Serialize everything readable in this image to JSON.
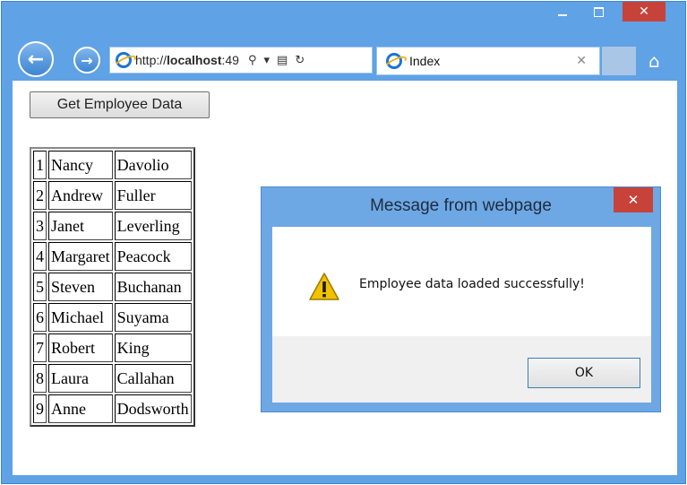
{
  "browser": {
    "url_prefix": "http://",
    "url_host": "localhost",
    "url_rest": ":49",
    "tab_title": "Index",
    "window_controls": {
      "minimize_icon": "minimize-icon",
      "maximize_icon": "maximize-icon",
      "close_glyph": "✕"
    },
    "icons": {
      "back": "←",
      "forward": "→",
      "search": "⚲",
      "dropdown": "▾",
      "compat": "▤",
      "refresh": "↻",
      "tab_close": "✕",
      "home": "⌂"
    }
  },
  "page": {
    "button_label": "Get Employee Data",
    "employees": [
      {
        "id": "1",
        "first": "Nancy",
        "last": "Davolio"
      },
      {
        "id": "2",
        "first": "Andrew",
        "last": "Fuller"
      },
      {
        "id": "3",
        "first": "Janet",
        "last": "Leverling"
      },
      {
        "id": "4",
        "first": "Margaret",
        "last": "Peacock"
      },
      {
        "id": "5",
        "first": "Steven",
        "last": "Buchanan"
      },
      {
        "id": "6",
        "first": "Michael",
        "last": "Suyama"
      },
      {
        "id": "7",
        "first": "Robert",
        "last": "King"
      },
      {
        "id": "8",
        "first": "Laura",
        "last": "Callahan"
      },
      {
        "id": "9",
        "first": "Anne",
        "last": "Dodsworth"
      }
    ]
  },
  "dialog": {
    "title": "Message from webpage",
    "message": "Employee data loaded successfully!",
    "ok_label": "OK",
    "close_glyph": "✕",
    "icon": "warning-icon"
  },
  "colors": {
    "frame": "#5fa2e6",
    "close_red": "#c7433a",
    "dialog_frame": "#6ea8e4",
    "warning_yellow": "#f2c100"
  }
}
